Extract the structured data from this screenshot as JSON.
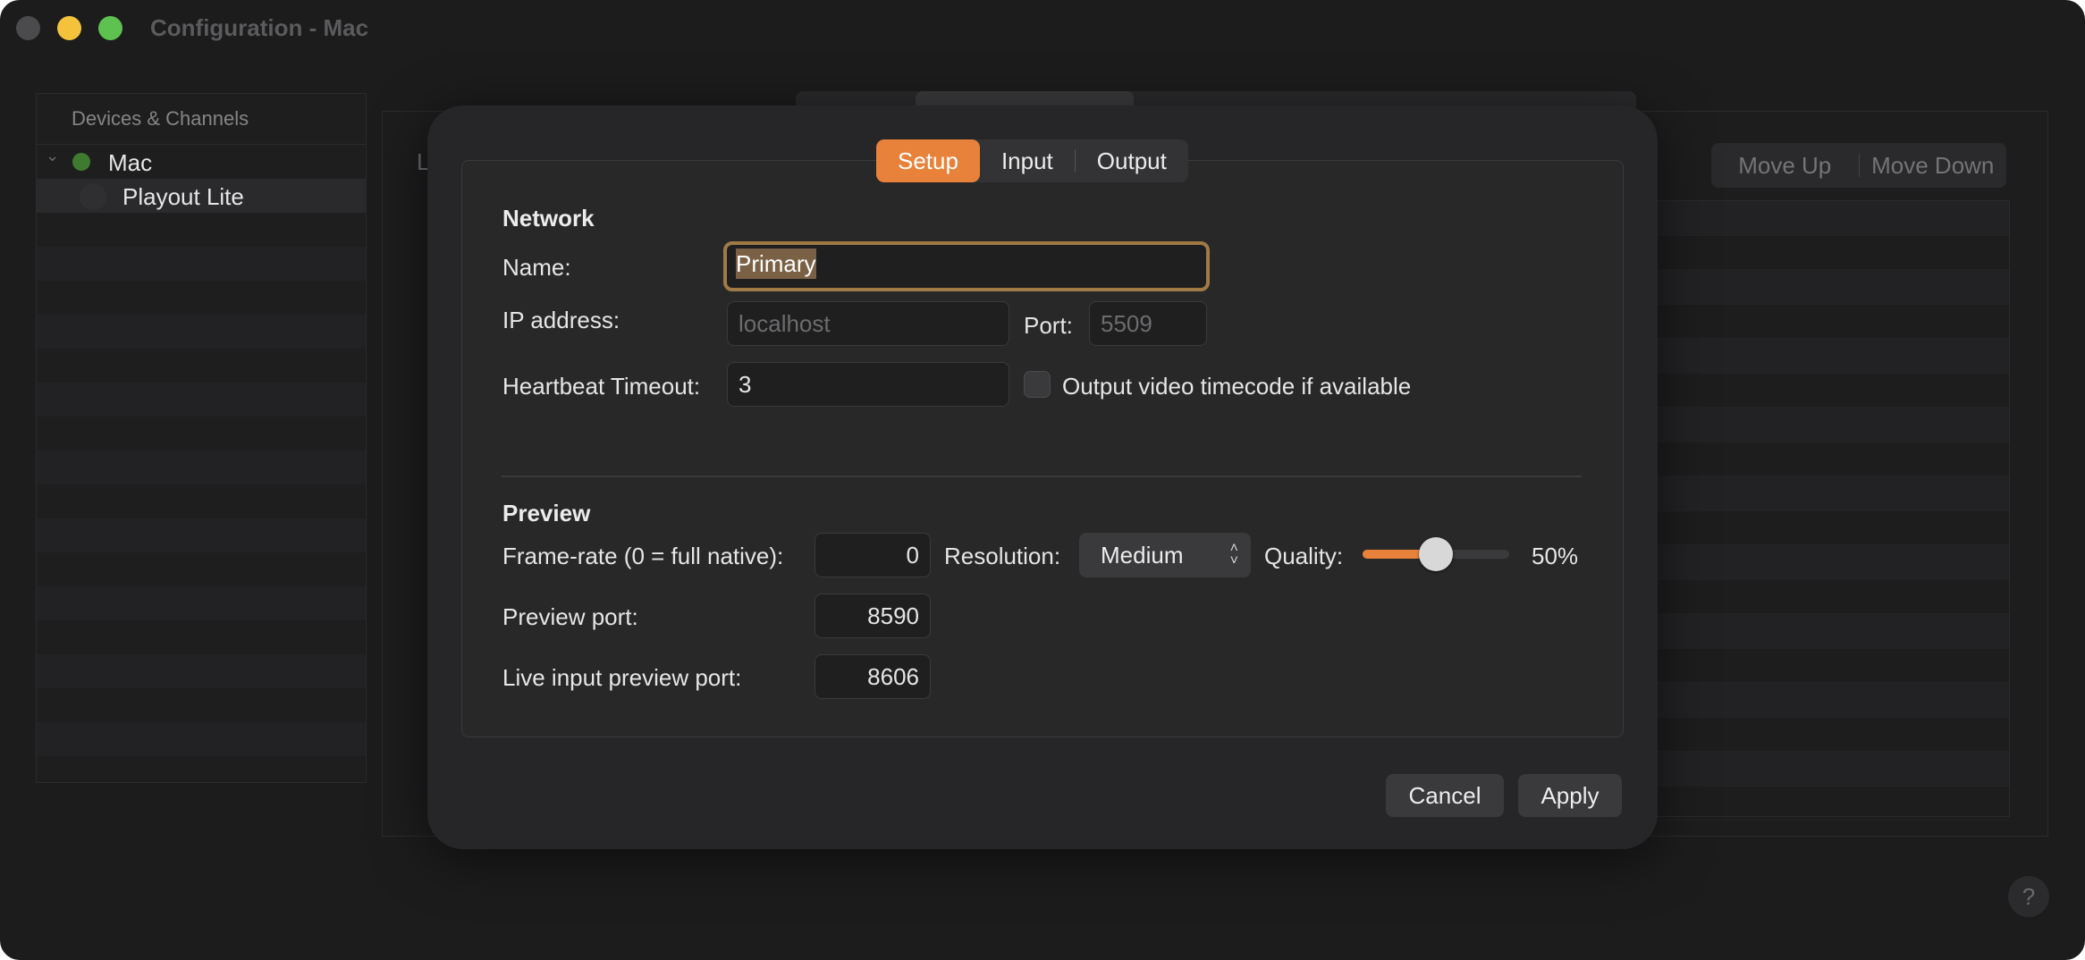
{
  "window": {
    "title": "Configuration - Mac"
  },
  "sidebar": {
    "header": "Devices & Channels",
    "device": "Mac",
    "channel": "Playout Lite"
  },
  "background": {
    "stub_label": "L",
    "move_up": "Move Up",
    "move_down": "Move Down",
    "help": "?"
  },
  "dialog": {
    "tabs": [
      "Setup",
      "Input",
      "Output"
    ],
    "active_tab": "Setup",
    "network": {
      "section": "Network",
      "name_label": "Name:",
      "name_value": "Primary",
      "ip_label": "IP address:",
      "ip_placeholder": "localhost",
      "port_label": "Port:",
      "port_placeholder": "5509",
      "heartbeat_label": "Heartbeat Timeout:",
      "heartbeat_value": "3",
      "timecode_label": "Output video timecode if available",
      "timecode_checked": false
    },
    "preview": {
      "section": "Preview",
      "framerate_label": "Frame-rate (0 = full native):",
      "framerate_value": "0",
      "resolution_label": "Resolution:",
      "resolution_value": "Medium",
      "quality_label": "Quality:",
      "quality_value": 0.5,
      "quality_text": "50%",
      "preview_port_label": "Preview port:",
      "preview_port_value": "8590",
      "live_port_label": "Live input preview port:",
      "live_port_value": "8606"
    },
    "cancel": "Cancel",
    "apply": "Apply"
  },
  "colors": {
    "accent": "#e8823a",
    "background": "#1c1c1d",
    "focus_ring": "#a07a44"
  }
}
